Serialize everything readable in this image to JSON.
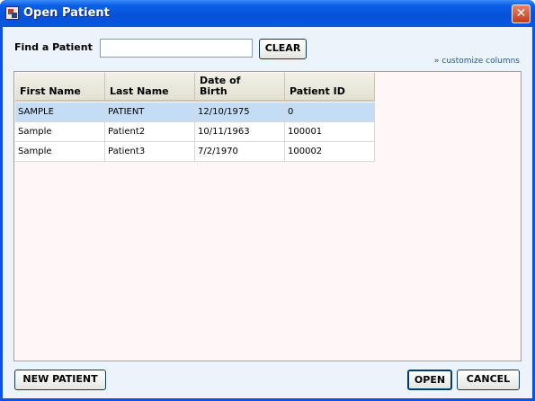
{
  "window": {
    "title": "Open Patient",
    "close_label": "✕"
  },
  "search": {
    "label": "Find a Patient",
    "value": "",
    "placeholder": "",
    "clear_label": "CLEAR"
  },
  "customize_label": "customize columns",
  "table": {
    "headers": [
      "First Name",
      "Last Name",
      "Date of Birth",
      "Patient ID"
    ],
    "rows": [
      [
        "SAMPLE",
        "PATIENT",
        "12/10/1975",
        "0"
      ],
      [
        "Sample",
        "Patient2",
        "10/11/1963",
        "100001"
      ],
      [
        "Sample",
        "Patient3",
        "7/2/1970",
        "100002"
      ]
    ],
    "selected_row": 0
  },
  "buttons": {
    "new_patient": "NEW PATIENT",
    "open": "OPEN",
    "cancel": "CANCEL"
  },
  "colors": {
    "titlebar": "#0a5fe8",
    "selection": "#c4ddf5",
    "panel_bg": "#ecf3fb"
  }
}
